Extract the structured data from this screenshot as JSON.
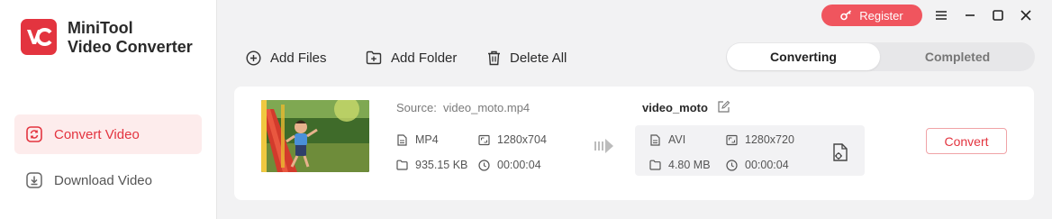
{
  "app": {
    "name_line1": "MiniTool",
    "name_line2": "Video Converter",
    "logo_text": "VC",
    "accent": "#e3343f"
  },
  "sidebar": {
    "items": [
      {
        "label": "Convert Video",
        "icon": "convert-icon",
        "active": true
      },
      {
        "label": "Download Video",
        "icon": "download-icon",
        "active": false
      }
    ]
  },
  "titlebar": {
    "register_label": "Register",
    "register_icon": "key-icon",
    "controls": [
      "menu-icon",
      "minimize-icon",
      "maximize-icon",
      "close-icon"
    ]
  },
  "toolbar": {
    "add_files": "Add Files",
    "add_folder": "Add Folder",
    "delete_all": "Delete All"
  },
  "tabs": {
    "converting": "Converting",
    "completed": "Completed",
    "active": "converting"
  },
  "task": {
    "source_label": "Source:",
    "source_file": "video_moto.mp4",
    "source": {
      "format": "MP4",
      "resolution": "1280x704",
      "size": "935.15 KB",
      "duration": "00:00:04"
    },
    "output_name": "video_moto",
    "output": {
      "format": "AVI",
      "resolution": "1280x720",
      "size": "4.80 MB",
      "duration": "00:00:04"
    },
    "convert_label": "Convert"
  }
}
